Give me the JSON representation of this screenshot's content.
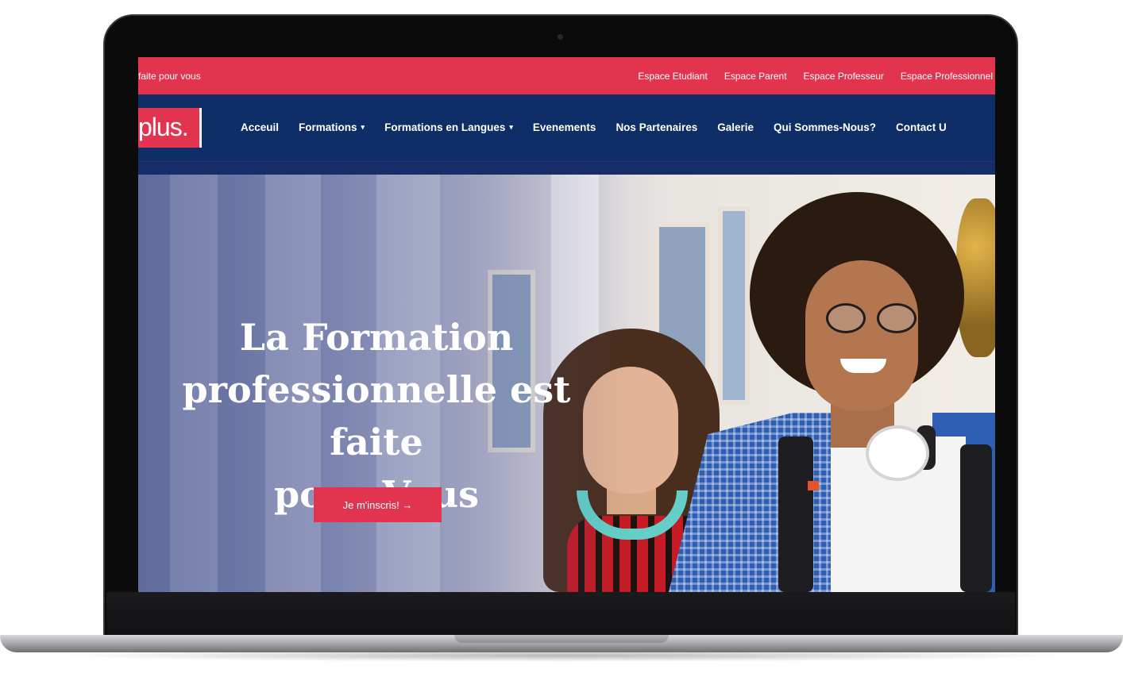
{
  "topbar": {
    "tagline": "faite pour vous",
    "links": [
      "Espace Etudiant",
      "Espace Parent",
      "Espace Professeur",
      "Espace Professionnel"
    ]
  },
  "nav": {
    "logo_text": "plus.",
    "items": [
      {
        "label": "Acceuil",
        "has_dropdown": false
      },
      {
        "label": "Formations",
        "has_dropdown": true
      },
      {
        "label": "Formations en Langues",
        "has_dropdown": true
      },
      {
        "label": "Evenements",
        "has_dropdown": false
      },
      {
        "label": "Nos Partenaires",
        "has_dropdown": false
      },
      {
        "label": "Galerie",
        "has_dropdown": false
      },
      {
        "label": "Qui Sommes-Nous?",
        "has_dropdown": false
      },
      {
        "label": "Contact U",
        "has_dropdown": false
      }
    ],
    "dropdown_icon": "chevron-down-icon"
  },
  "hero": {
    "headline_lines": [
      "La Formation",
      "professionnelle est faite",
      "pour Vous"
    ],
    "cta_label": "Je m'inscris! →"
  },
  "colors": {
    "accent_red": "#e3344f",
    "nav_navy": "#0f2d66",
    "text_white": "#ffffff"
  }
}
